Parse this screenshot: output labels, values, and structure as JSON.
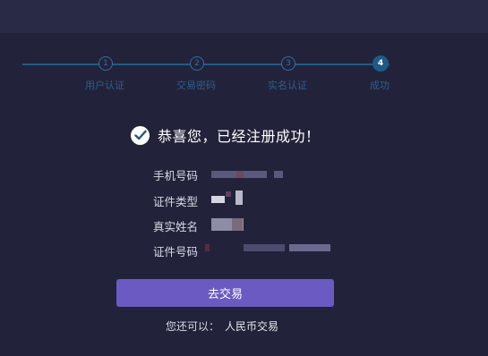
{
  "steps": [
    {
      "num": "1",
      "label": "用户认证"
    },
    {
      "num": "2",
      "label": "交易密码"
    },
    {
      "num": "3",
      "label": "实名认证"
    },
    {
      "num": "4",
      "label": "成功"
    }
  ],
  "success": {
    "message": "恭喜您，已经注册成功！"
  },
  "info": {
    "phone_label": "手机号码",
    "id_type_label": "证件类型",
    "real_name_label": "真实姓名",
    "id_number_label": "证件号码"
  },
  "actions": {
    "go_trade_label": "去交易",
    "also_can_text": "您还可以：",
    "rmb_trade_link": "人民币交易"
  },
  "colors": {
    "background": "#22233a",
    "accent_button": "#6b5ac2",
    "step_blue": "#1f5a87"
  }
}
